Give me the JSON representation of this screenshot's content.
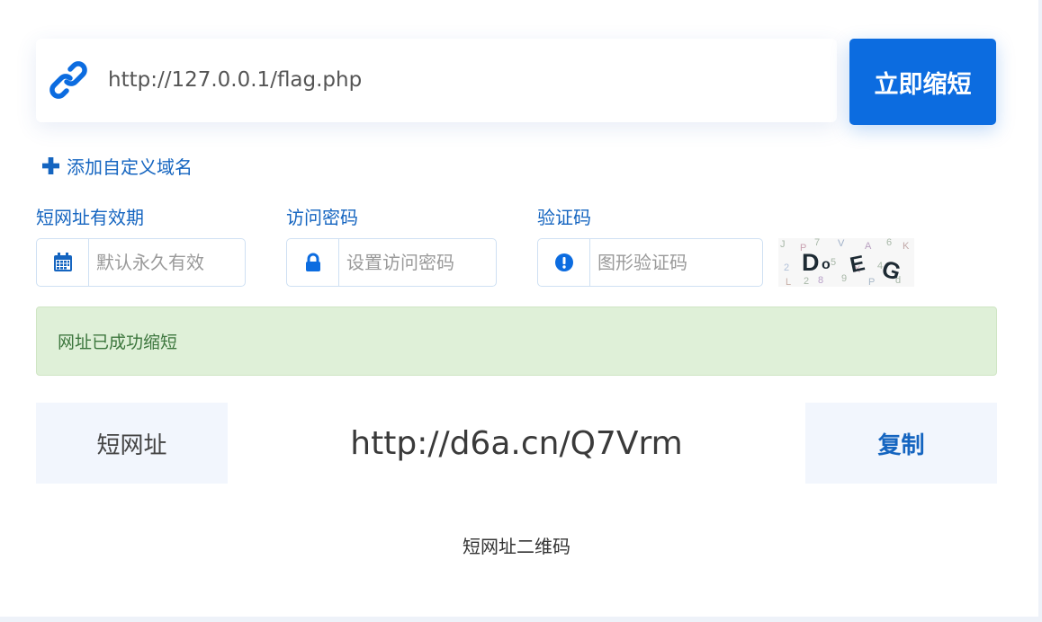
{
  "url_input": {
    "value": "http://127.0.0.1/flag.php"
  },
  "shorten_button": {
    "label": "立即缩短"
  },
  "add_domain": {
    "label": "添加自定义域名"
  },
  "expiry": {
    "label": "短网址有效期",
    "placeholder": "默认永久有效",
    "icon": "calendar-icon"
  },
  "password": {
    "label": "访问密码",
    "placeholder": "设置访问密码",
    "icon": "lock-icon"
  },
  "captcha": {
    "label": "验证码",
    "placeholder": "图形验证码",
    "icon": "exclamation-circle-icon",
    "image_text": "D E G"
  },
  "alert": {
    "message": "网址已成功缩短"
  },
  "result": {
    "label": "短网址",
    "url": "http://d6a.cn/Q7Vrm",
    "copy_label": "复制"
  },
  "qr": {
    "label": "短网址二维码"
  },
  "colors": {
    "primary": "#0c6ce0",
    "label": "#1565c0",
    "success_bg": "#dff0d8",
    "success_text": "#3c763d",
    "result_bg": "#f2f6fd"
  }
}
